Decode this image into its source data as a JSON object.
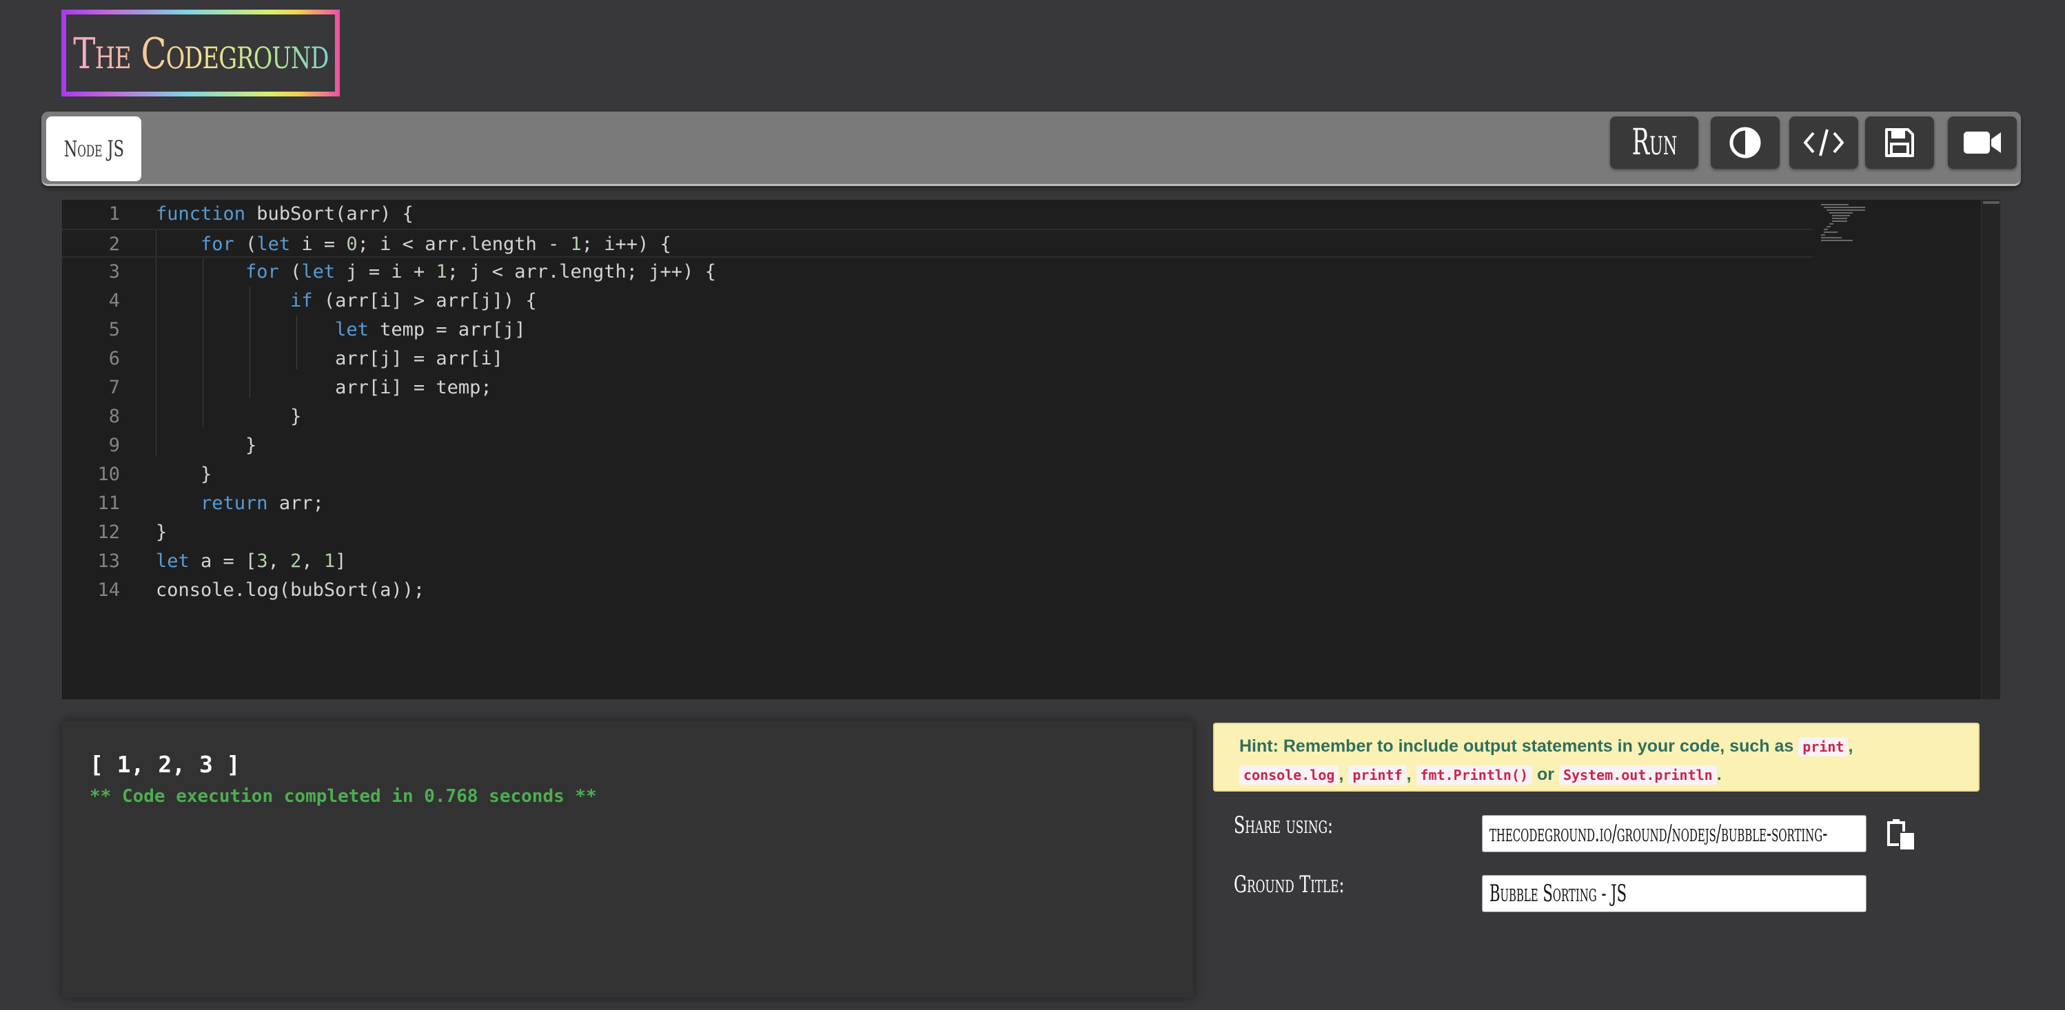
{
  "app": {
    "title": "The Codeground"
  },
  "toolbar": {
    "language_tab": "Node JS",
    "run_label": "Run",
    "icons": [
      "contrast-icon",
      "code-icon",
      "save-icon",
      "video-camera-icon"
    ]
  },
  "editor": {
    "lines": [
      {
        "n": "1",
        "code": "function bubSort(arr) {"
      },
      {
        "n": "2",
        "code": "    for (let i = 0; i < arr.length - 1; i++) {"
      },
      {
        "n": "3",
        "code": "        for (let j = i + 1; j < arr.length; j++) {"
      },
      {
        "n": "4",
        "code": "            if (arr[i] > arr[j]) {"
      },
      {
        "n": "5",
        "code": "                let temp = arr[j]"
      },
      {
        "n": "6",
        "code": "                arr[j] = arr[i]"
      },
      {
        "n": "7",
        "code": "                arr[i] = temp;"
      },
      {
        "n": "8",
        "code": "            }"
      },
      {
        "n": "9",
        "code": "        }"
      },
      {
        "n": "10",
        "code": "    }"
      },
      {
        "n": "11",
        "code": "    return arr;"
      },
      {
        "n": "12",
        "code": "}"
      },
      {
        "n": "13",
        "code": "let a = [3, 2, 1]"
      },
      {
        "n": "14",
        "code": "console.log(bubSort(a));"
      }
    ]
  },
  "output": {
    "result": "[ 1, 2, 3 ]",
    "status": "** Code execution completed in 0.768 seconds **"
  },
  "hint": {
    "text": "Hint: Remember to include output statements in your code, such as",
    "examples": [
      "print",
      "console.log",
      "printf",
      "fmt.Println()",
      "System.out.println"
    ],
    "or": "or"
  },
  "share": {
    "label": "Share using:",
    "url": "thecodeground.io/ground/nodejs/bubble-sorting-"
  },
  "ground_title": {
    "label": "Ground Title:",
    "value": "Bubble Sorting - JS"
  },
  "colors": {
    "background": "#38373a",
    "toolbar": "#7a7a7a",
    "button": "#393939",
    "editor": "#1e1e1e",
    "keyword": "#569cd6",
    "number": "#b5cea8",
    "output_status": "#4caf50",
    "hint_bg": "#fbf1b4",
    "hint_text": "#2f6f5f"
  }
}
